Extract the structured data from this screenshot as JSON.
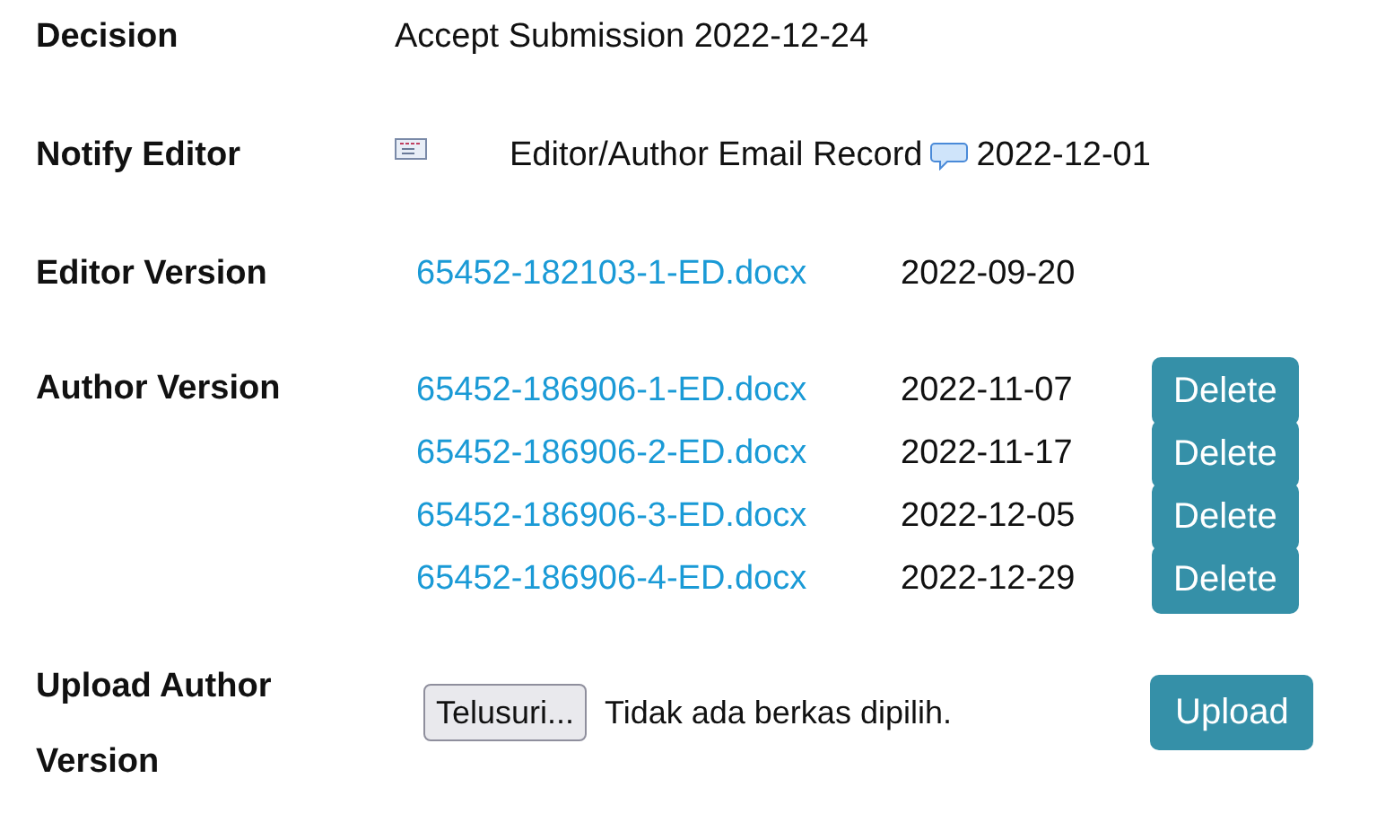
{
  "decision": {
    "label": "Decision",
    "value": "Accept Submission 2022-12-24"
  },
  "notify_editor": {
    "label": "Notify Editor",
    "link": "Editor/Author Email Record",
    "date": "2022-12-01"
  },
  "editor_version": {
    "label": "Editor Version",
    "file": "65452-182103-1-ED.docx",
    "date": "2022-09-20"
  },
  "author_version": {
    "label": "Author Version",
    "files": [
      {
        "file": "65452-186906-1-ED.docx",
        "date": "2022-11-07",
        "button": "Delete"
      },
      {
        "file": "65452-186906-2-ED.docx",
        "date": "2022-11-17",
        "button": "Delete"
      },
      {
        "file": "65452-186906-3-ED.docx",
        "date": "2022-12-05",
        "button": "Delete"
      },
      {
        "file": "65452-186906-4-ED.docx",
        "date": "2022-12-29",
        "button": "Delete"
      }
    ]
  },
  "upload_author_version": {
    "label": "Upload Author Version",
    "browse_button": "Telusuri...",
    "file_status": "Tidak ada berkas dipilih.",
    "upload_button": "Upload"
  }
}
